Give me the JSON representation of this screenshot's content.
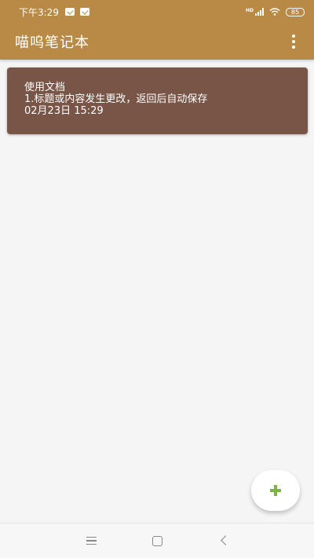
{
  "status_bar": {
    "time": "下午3:29",
    "network_label": "HD",
    "battery": "85"
  },
  "app_bar": {
    "title": "喵呜笔记本"
  },
  "notes": [
    {
      "title": "使用文档",
      "body": "1.标题或内容发生更改，返回后自动保存",
      "time": "02月23日 15:29",
      "color": "#795548"
    }
  ],
  "colors": {
    "primary": "#b98a45",
    "note_card": "#795548",
    "fab_icon": "#7cb342",
    "background": "#f5f5f5"
  },
  "icons": {
    "overflow": "more-vert-icon",
    "fab": "plus-icon",
    "nav_menu": "menu-icon",
    "nav_home": "home-icon",
    "nav_back": "back-icon"
  }
}
